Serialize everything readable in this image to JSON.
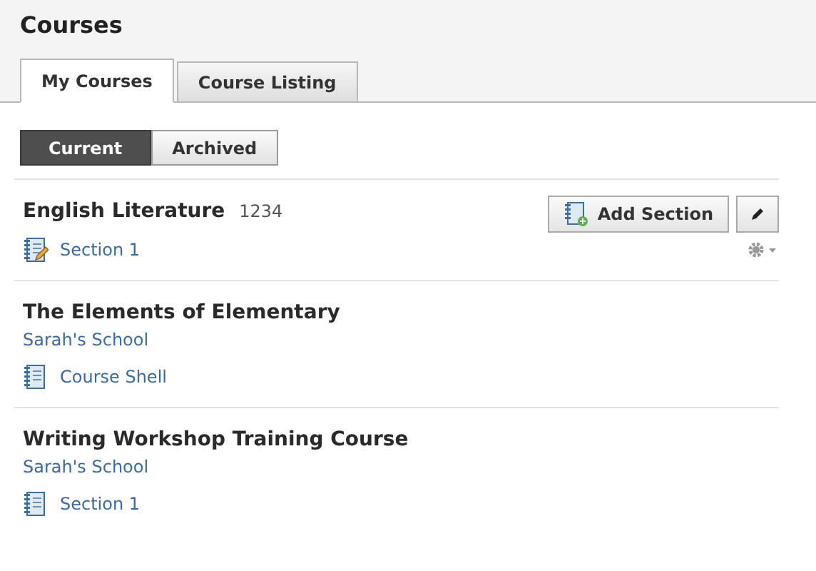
{
  "page": {
    "title": "Courses"
  },
  "tabs": [
    {
      "label": "My Courses",
      "selected": true
    },
    {
      "label": "Course Listing",
      "selected": false
    }
  ],
  "filters": [
    {
      "label": "Current",
      "selected": true
    },
    {
      "label": "Archived",
      "selected": false
    }
  ],
  "courses": [
    {
      "title": "English Literature",
      "code": "1234",
      "actions": {
        "add_section": "Add Section"
      },
      "sections": [
        {
          "label": "Section 1",
          "kind": "editable"
        }
      ]
    },
    {
      "title": "The Elements of Elementary",
      "school": "Sarah's School",
      "sections": [
        {
          "label": "Course Shell",
          "kind": "plain"
        }
      ]
    },
    {
      "title": "Writing Workshop Training Course",
      "school": "Sarah's School",
      "sections": [
        {
          "label": "Section 1",
          "kind": "plain"
        }
      ]
    }
  ]
}
